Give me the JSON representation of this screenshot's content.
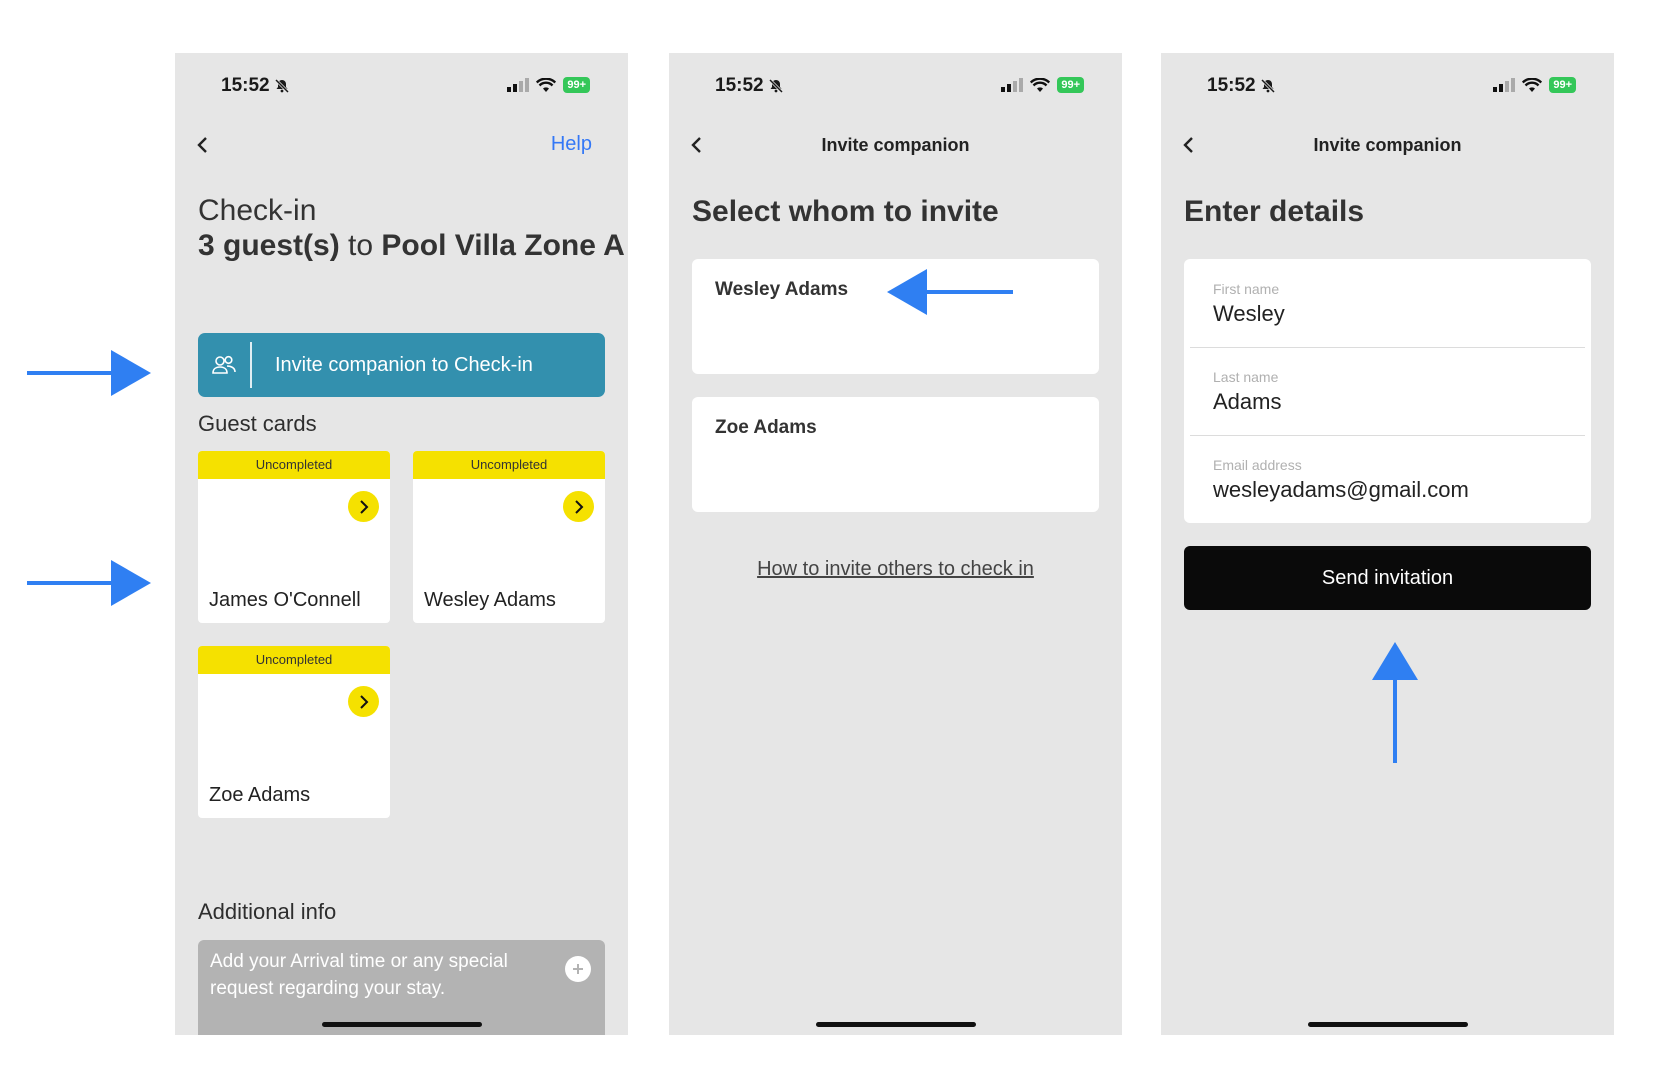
{
  "status_bar": {
    "time": "15:52",
    "battery": "99+"
  },
  "screen1": {
    "help_label": "Help",
    "checkin_label": "Check-in",
    "guest_count": "3 guest(s)",
    "to_word": "to",
    "villa_name": "Pool Villa Zone A",
    "invite_button_label": "Invite companion to Check-in",
    "guest_cards_heading": "Guest cards",
    "guest_cards": [
      {
        "status": "Uncompleted",
        "name": "James O'Connell"
      },
      {
        "status": "Uncompleted",
        "name": "Wesley Adams"
      },
      {
        "status": "Uncompleted",
        "name": "Zoe Adams"
      }
    ],
    "additional_info_heading": "Additional info",
    "additional_info_text": "Add your Arrival time or any special request regarding your stay."
  },
  "screen2": {
    "nav_title": "Invite companion",
    "heading": "Select whom to invite",
    "companions": [
      "Wesley Adams",
      "Zoe Adams"
    ],
    "help_link": "How to invite others to check in"
  },
  "screen3": {
    "nav_title": "Invite companion",
    "heading": "Enter details",
    "fields": [
      {
        "label": "First name",
        "value": "Wesley"
      },
      {
        "label": "Last name",
        "value": "Adams"
      },
      {
        "label": "Email address",
        "value": "wesleyadams@gmail.com"
      }
    ],
    "send_button_label": "Send invitation"
  },
  "colors": {
    "accent_teal": "#3390ae",
    "badge_yellow": "#f5e100",
    "link_blue": "#3478f6",
    "annotation_blue": "#2f7ff2",
    "send_black": "#0a0a0a"
  },
  "icons": [
    "bell-slash-icon",
    "signal-icon",
    "wifi-icon",
    "battery-icon",
    "back-chevron-icon",
    "people-icon",
    "chevron-right-icon",
    "plus-icon",
    "arrow-annotation-icon"
  ]
}
